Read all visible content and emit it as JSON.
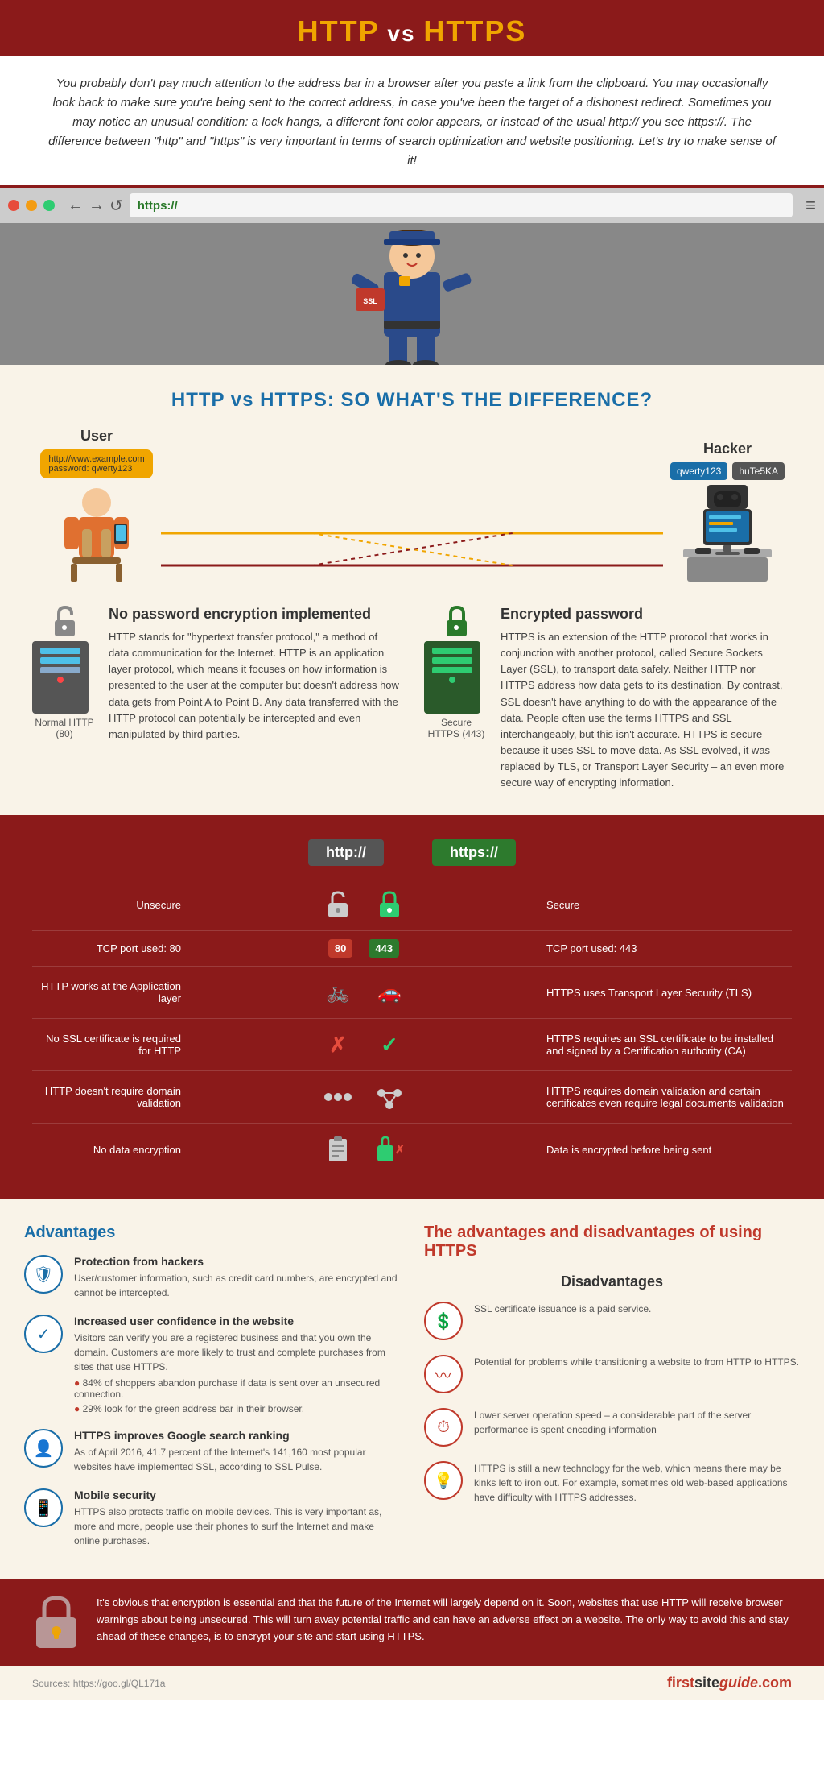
{
  "header": {
    "title_http": "HTTP",
    "title_vs": " vs ",
    "title_https": "HTTPS"
  },
  "intro": {
    "text": "You probably don't pay much attention to the address bar in a browser after you paste a link from the clipboard. You may occasionally look back to make sure you're being sent to the correct address, in case you've been the target of a dishonest redirect. Sometimes you may notice an unusual condition: a lock hangs, a different font color appears, or instead of the usual http:// you see https://. The difference between \"http\" and \"https\" is very important in terms of search optimization and website positioning. Let's try to make sense of it!"
  },
  "browser": {
    "url": "https://",
    "nav_back": "←",
    "nav_forward": "→",
    "nav_refresh": "↺"
  },
  "difference": {
    "title": "HTTP vs HTTPS: SO WHAT'S THE DIFFERENCE?",
    "user_label": "User",
    "hacker_label": "Hacker",
    "user_bubble_line1": "http://www.example.com",
    "user_bubble_line2": "password: qwerty123",
    "hacker_bubble": "qwerty123",
    "hacker_bubble2": "huTe5KA",
    "no_enc_title": "No password encryption implemented",
    "enc_title": "Encrypted password",
    "http_label": "Normal HTTP (80)",
    "https_label": "Secure HTTPS (443)",
    "http_desc": "HTTP stands for \"hypertext transfer protocol,\" a method of data communication for the Internet. HTTP is an application layer protocol, which means it focuses on how information is presented to the user at the computer but doesn't address how data gets from Point A to Point B. Any data transferred with the HTTP protocol can potentially be intercepted and even manipulated by third parties.",
    "https_desc": "HTTPS is an extension of the HTTP protocol that works in conjunction with another protocol, called Secure Sockets Layer (SSL), to transport data safely. Neither HTTP nor HTTPS address how data gets to its destination. By contrast, SSL doesn't have anything to do with the appearance of the data. People often use the terms HTTPS and SSL interchangeably, but this isn't accurate. HTTPS is secure because it uses SSL to move data. As SSL evolved, it was replaced by TLS, or Transport Layer Security – an even more secure way of encrypting information."
  },
  "comparison": {
    "http_header": "http://",
    "https_header": "https://",
    "rows": [
      {
        "left": "Unsecure",
        "icon_left": "🔓",
        "icon_right": "🔒",
        "right": "Secure"
      },
      {
        "left": "TCP port used: 80",
        "port_left": "80",
        "port_right": "443",
        "right": "TCP port used: 443"
      },
      {
        "left": "HTTP works at the Application layer",
        "icon_left": "🚲",
        "icon_right": "🚗",
        "right": "HTTPS uses Transport Layer Security (TLS)"
      },
      {
        "left": "No SSL certificate is required for HTTP",
        "icon_left": "✗",
        "icon_right": "✓",
        "right": "HTTPS requires an SSL certificate to be installed and signed by a Certification authority (CA)"
      },
      {
        "left": "HTTP doesn't require domain validation",
        "icon_left": "⚙",
        "icon_right": "⚙",
        "right": "HTTPS requires domain validation and certain certificates even require legal documents validation"
      },
      {
        "left": "No data encryption",
        "icon_left": "📋",
        "icon_right": "❌",
        "right": "Data is encrypted before being sent"
      }
    ]
  },
  "advantages": {
    "section_title": "The advantages and disadvantages of using HTTPS",
    "adv_title": "Advantages",
    "items": [
      {
        "icon": "🛡",
        "title": "Protection from hackers",
        "text": "User/customer information, such as credit card numbers, are encrypted and cannot be intercepted."
      },
      {
        "icon": "✓",
        "title": "Increased user confidence in the website",
        "text": "Visitors can verify you are a registered business and that you own the domain. Customers are more likely to trust and complete purchases from sites that use HTTPS.",
        "stat1": "84% of shoppers abandon purchase if data is sent over an unsecured connection.",
        "stat2": "29% look for the green address bar in their browser."
      },
      {
        "icon": "👤",
        "title": "HTTPS improves Google search ranking",
        "text": "As of April 2016, 41.7 percent of the Internet's 141,160 most popular websites have implemented SSL, according to SSL Pulse."
      },
      {
        "icon": "📱",
        "title": "Mobile security",
        "text": "HTTPS also protects traffic on mobile devices. This is very important as, more and more, people use their phones to surf the Internet and make online purchases."
      }
    ],
    "dis_title": "Disadvantages",
    "dis_items": [
      {
        "icon": "💲",
        "text": "SSL certificate issuance is a paid service."
      },
      {
        "icon": "〰",
        "text": "Potential for problems while transitioning a website to from HTTP to HTTPS."
      },
      {
        "icon": "⏱",
        "text": "Lower server operation speed – a considerable part of the server performance is spent encoding information"
      },
      {
        "icon": "💡",
        "text": "HTTPS is still a new technology for the web, which means there may be kinks left to iron out. For example, sometimes old web-based applications have difficulty with HTTPS addresses."
      }
    ]
  },
  "footer": {
    "text": "It's obvious that encryption is essential and that the future of the Internet will largely depend on it. Soon, websites that use HTTP will receive browser warnings about being unsecured. This will turn away potential traffic and can have an adverse effect on a website. The only way to avoid this and stay ahead of these changes, is to encrypt your site and start using HTTPS.",
    "source": "Sources: https://goo.gl/QL171a",
    "brand_first": "first",
    "brand_site": "site",
    "brand_guide": "guide",
    "brand_com": ".com"
  }
}
